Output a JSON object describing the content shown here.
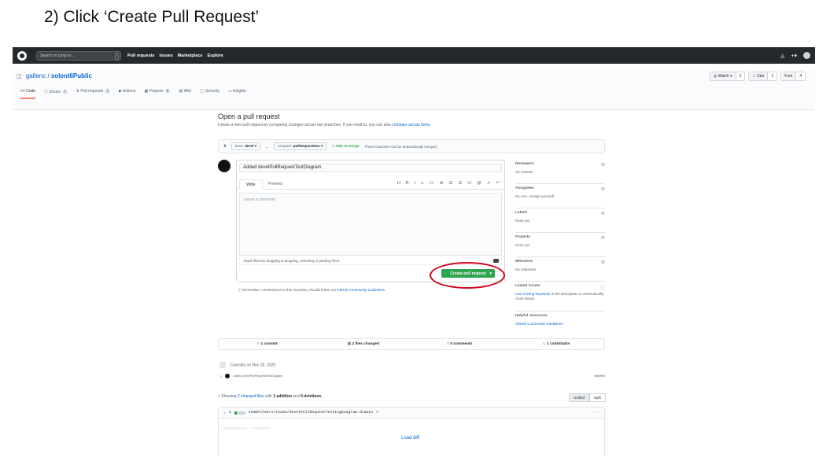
{
  "instruction": "2)    Click ‘Create Pull Request’",
  "header": {
    "search_placeholder": "Search or jump to...",
    "search_key": "/",
    "nav": [
      "Pull requests",
      "Issues",
      "Marketplace",
      "Explore"
    ],
    "right_icons": [
      "bell-icon",
      "plus-icon",
      "avatar"
    ]
  },
  "repo": {
    "owner": "gallenc",
    "separator": "/",
    "name": "solent6Public",
    "watch_label": "◎ Watch ▾",
    "watch_count": "2",
    "star_label": "☆ Star",
    "star_count": "1",
    "fork_label": "Fork",
    "fork_count": "4",
    "tabs": [
      {
        "label": "<> Code",
        "count": ""
      },
      {
        "label": "ⓘ Issues",
        "count": "7"
      },
      {
        "label": "Pull requests",
        "count": "1"
      },
      {
        "label": "▶ Actions",
        "count": ""
      },
      {
        "label": "Projects",
        "count": "0"
      },
      {
        "label": "Wiki",
        "count": ""
      },
      {
        "label": "Security",
        "count": ""
      },
      {
        "label": "Insights",
        "count": ""
      }
    ]
  },
  "compare": {
    "title": "Open a pull request",
    "subtitle": "Create a new pull request by comparing changes across two branches. If you need to, you can also",
    "subtitle_link": "compare across forks.",
    "base_label": "base:",
    "base_value": "devel ▾",
    "arrow": "←",
    "compare_label": "compare:",
    "compare_value": "pullRequestDoc ▾",
    "able": "✓ Able to merge.",
    "able_rest": "These branches can be automatically merged."
  },
  "composer": {
    "title_value": "Added develPullRequestTestDiagram",
    "tab_write": "Write",
    "tab_preview": "Preview",
    "toolbar": [
      "H",
      "B",
      "I",
      "≡",
      "<>",
      "⊕",
      "☰",
      "☰",
      "☑",
      "@",
      "⇗",
      "↶"
    ],
    "comment_placeholder": "Leave a comment",
    "attach_text": "Attach files by dragging & dropping, selecting or pasting them.",
    "create_label": "Create pull request",
    "create_caret": "▾",
    "reminder": "Remember, contributions to this repository should follow our",
    "reminder_link": "GitHub Community Guidelines."
  },
  "sidebar": {
    "reviewers": {
      "h": "Reviewers",
      "v": "No reviews"
    },
    "assignees": {
      "h": "Assignees",
      "v": "No one—assign yourself"
    },
    "labels": {
      "h": "Labels",
      "v": "None yet"
    },
    "projects": {
      "h": "Projects",
      "v": "None yet"
    },
    "milestone": {
      "h": "Milestone",
      "v": "No milestone"
    },
    "linked": {
      "h": "Linked issues",
      "link": "Use Closing keywords",
      "v": "in the description to automatically close issues"
    },
    "helpful": {
      "h": "Helpful resources",
      "link": "GitHub Community Guidelines"
    }
  },
  "stats": {
    "commits": "1 commit",
    "files": "2 files changed",
    "comments": "0 comments",
    "contributors": "1 contributor"
  },
  "commits": {
    "date": "Commits on Nov 25, 2020",
    "message": "Added develPullRequestTestDiagram",
    "sha": "d8b8fb5"
  },
  "showing": {
    "prefix": "Showing",
    "files_link": "2 changed files",
    "middle": "with",
    "additions": "1 addition",
    "and": "and",
    "deletions": "0 deletions.",
    "unified": "Unified",
    "split": "Split"
  },
  "file": {
    "count": "1",
    "path": "teamFolders/team4/develPullRequestTestingDiagram.drawio",
    "more": "···",
    "load_diff": "Load diff"
  },
  "colors": {
    "header_bg": "#24292e",
    "green": "#2ea44f",
    "link": "#0366d6",
    "highlight": "#d0021b"
  }
}
